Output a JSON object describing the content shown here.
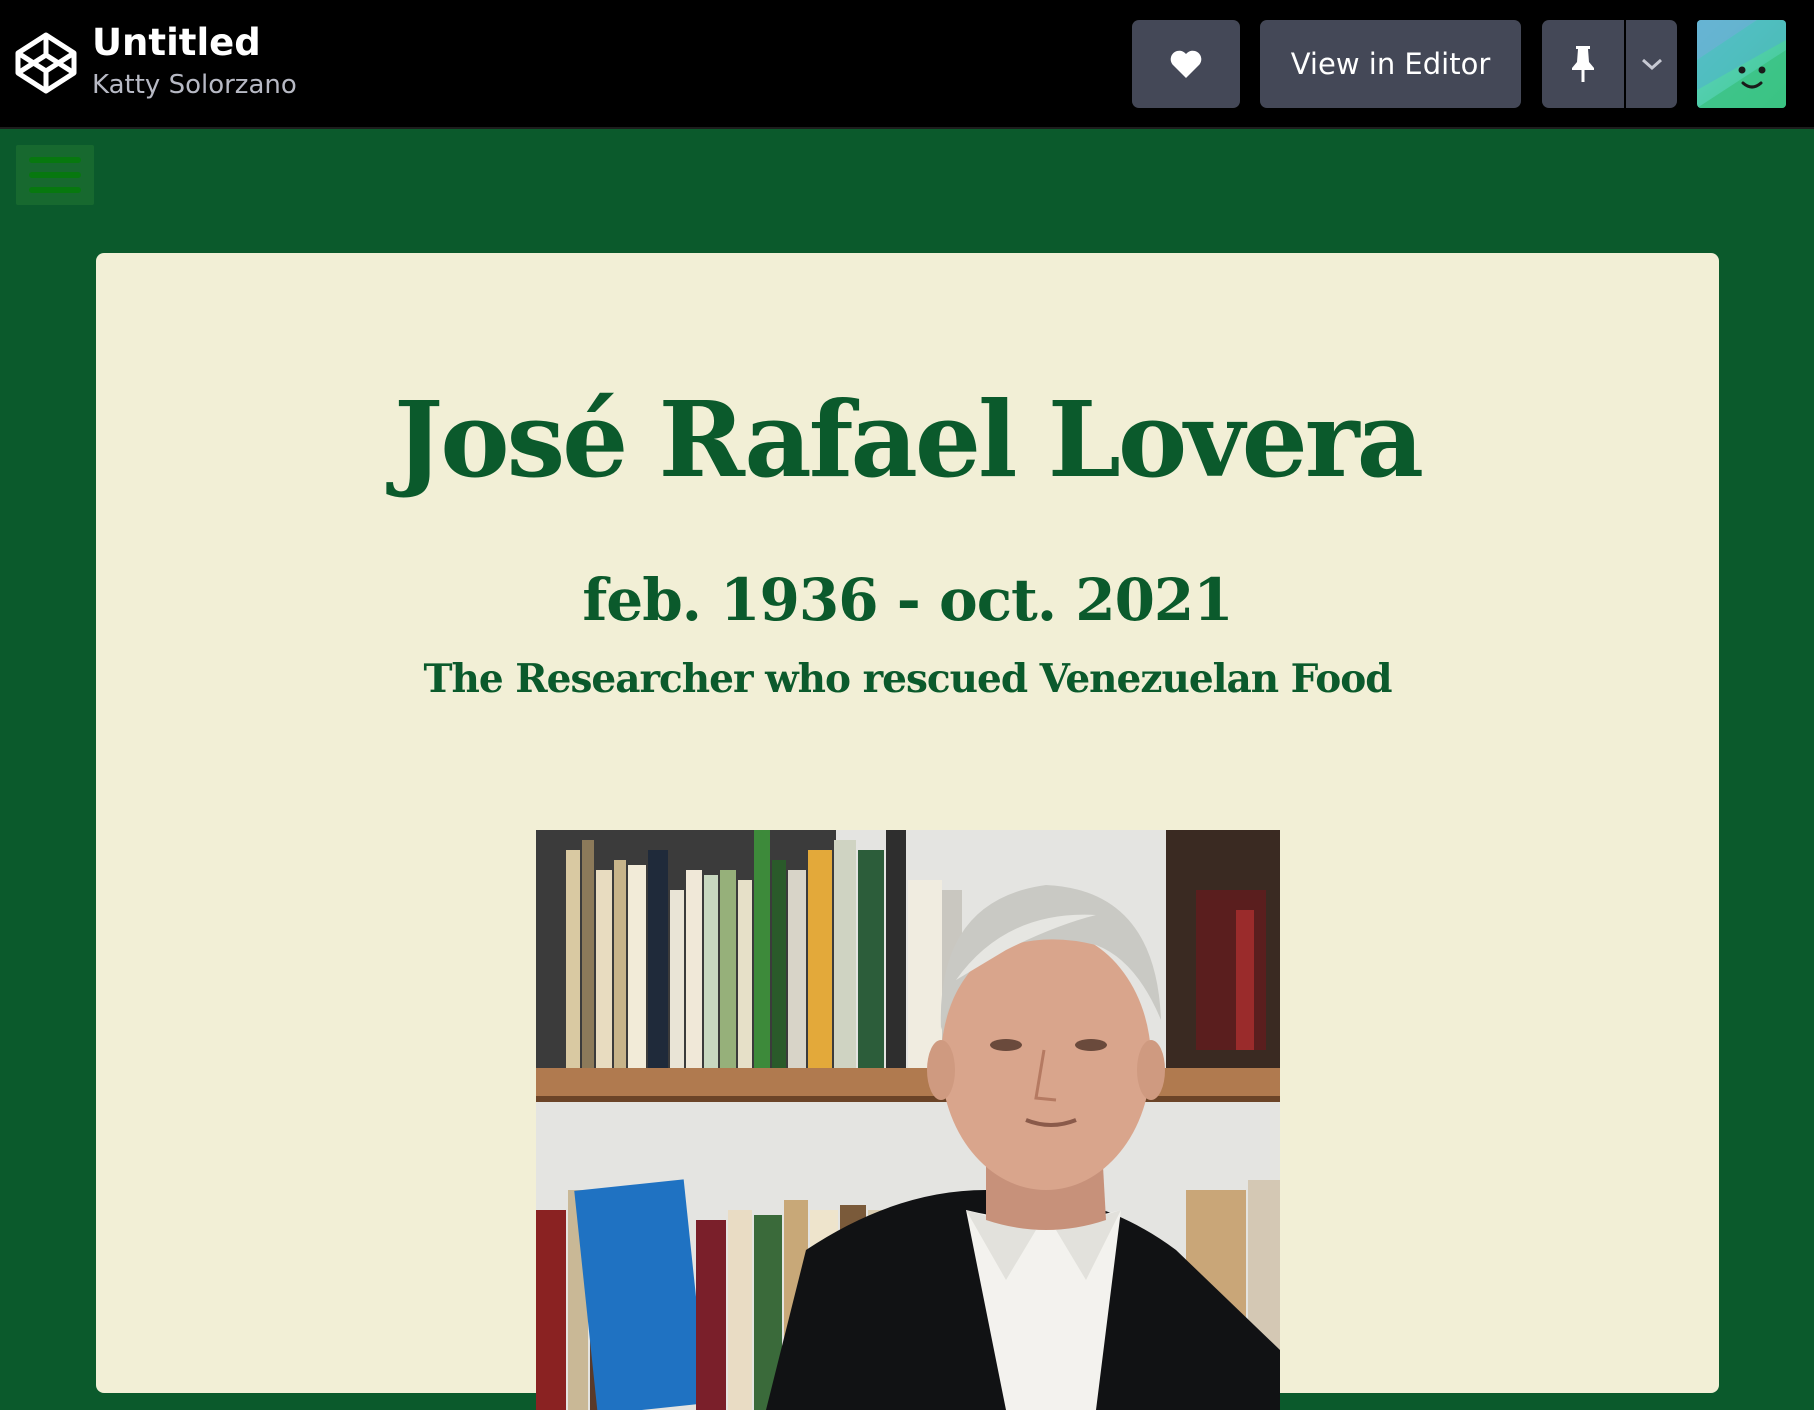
{
  "header": {
    "title": "Untitled",
    "author": "Katty Solorzano",
    "view_in_editor_label": "View in Editor",
    "icons": [
      "codepen-logo-icon",
      "heart-icon",
      "pin-icon",
      "chevron-down-icon"
    ]
  },
  "page": {
    "menu_icon": "hamburger-menu-icon",
    "name": "José Rafael Lovera",
    "dates": "feb. 1936 - oct. 2021",
    "tagline": "The Researcher who rescued Venezuelan Food"
  },
  "colors": {
    "page_background": "#0b5a2c",
    "card_background": "#f2efd6",
    "heading_text": "#0b5a2c",
    "topbar_background": "#000000",
    "button_background": "#444857"
  }
}
